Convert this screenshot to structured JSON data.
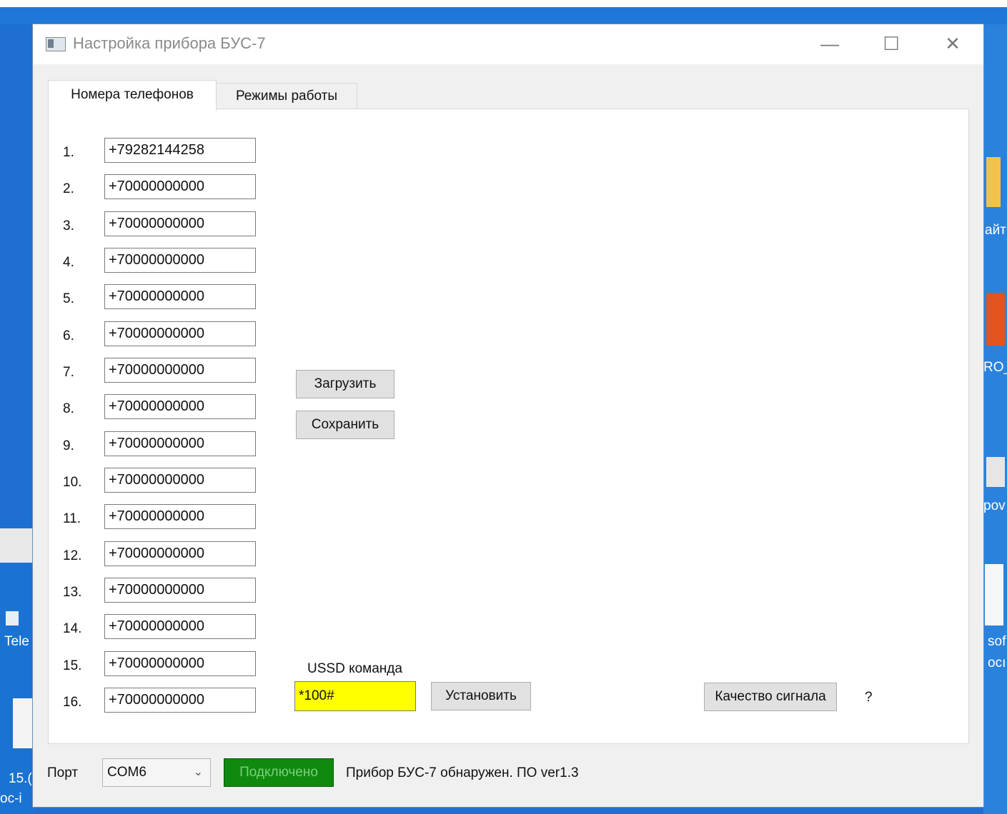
{
  "window": {
    "title": "Настройка прибора БУС-7",
    "controls": {
      "minimize": "—",
      "maximize": "☐",
      "close": "✕"
    }
  },
  "tabs": [
    {
      "label": "Номера телефонов",
      "active": true
    },
    {
      "label": "Режимы работы",
      "active": false
    }
  ],
  "phones": [
    {
      "num": "1.",
      "value": "+79282144258"
    },
    {
      "num": "2.",
      "value": "+70000000000"
    },
    {
      "num": "3.",
      "value": "+70000000000"
    },
    {
      "num": "4.",
      "value": "+70000000000"
    },
    {
      "num": "5.",
      "value": "+70000000000"
    },
    {
      "num": "6.",
      "value": "+70000000000"
    },
    {
      "num": "7.",
      "value": "+70000000000"
    },
    {
      "num": "8.",
      "value": "+70000000000"
    },
    {
      "num": "9.",
      "value": "+70000000000"
    },
    {
      "num": "10.",
      "value": "+70000000000"
    },
    {
      "num": "11.",
      "value": "+70000000000"
    },
    {
      "num": "12.",
      "value": "+70000000000"
    },
    {
      "num": "13.",
      "value": "+70000000000"
    },
    {
      "num": "14.",
      "value": "+70000000000"
    },
    {
      "num": "15.",
      "value": "+70000000000"
    },
    {
      "num": "16.",
      "value": "+70000000000"
    }
  ],
  "buttons": {
    "load": "Загрузить",
    "save": "Сохранить",
    "set": "Установить",
    "signal": "Качество сигнала"
  },
  "ussd": {
    "label": "USSD команда",
    "value": "*100#",
    "color": "#ffff00"
  },
  "signal_value": "?",
  "footer": {
    "port_label": "Порт",
    "port_value": "COM6",
    "connected_label": "Подключено",
    "connected_color": "#0f8a0f",
    "status": "Прибор БУС-7 обнаружен. ПО ver1.3"
  },
  "desktop": {
    "right_labels": [
      "айт",
      "RO_",
      "pov",
      "sof",
      "ocı"
    ],
    "left_labels": [
      "Tele",
      "15.(",
      "oc-i"
    ]
  }
}
